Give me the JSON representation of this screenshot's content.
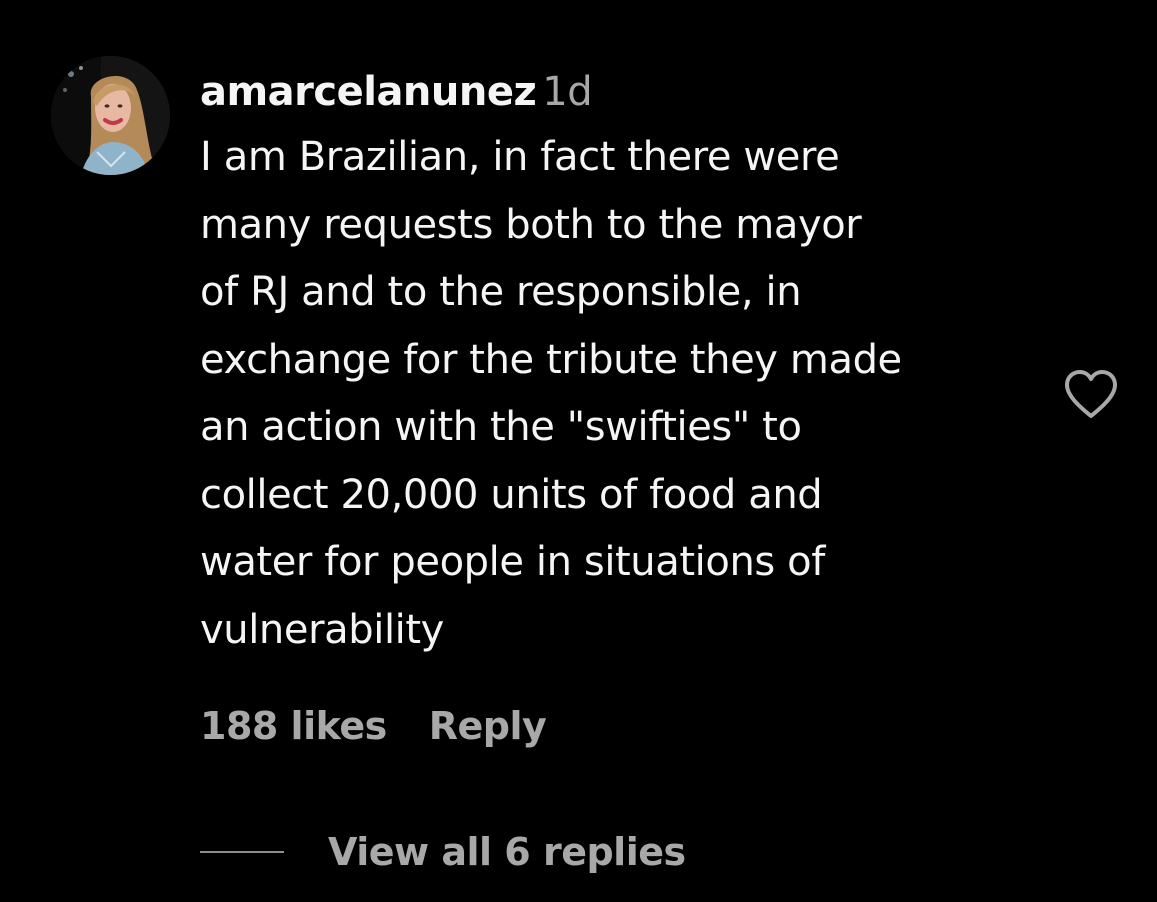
{
  "comment": {
    "username": "amarcelanunez",
    "time_ago": "1d",
    "text_lines": [
      "I am Brazilian, in fact there were",
      "many requests both to the mayor",
      "of RJ and to the responsible, in",
      "exchange for the tribute they made",
      "an action with the \"swifties\" to",
      "collect 20,000 units of food and",
      "water for people in situations of",
      "vulnerability"
    ],
    "likes": "188 likes",
    "reply_label": "Reply",
    "like_icon": "heart-outline-icon",
    "avatar_icon": "user-avatar"
  },
  "replies": {
    "view_all_label": "View all 6 replies"
  },
  "colors": {
    "background": "#000000",
    "primary_text": "#f5f5f5",
    "secondary_text": "#a8a8a8"
  }
}
